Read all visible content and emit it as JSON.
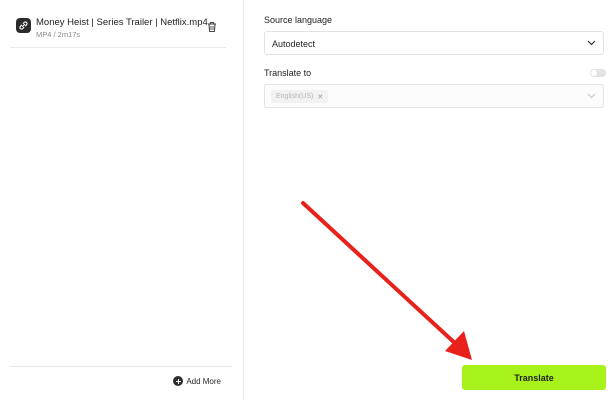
{
  "file": {
    "name": "Money Heist | Series Trailer | Netflix.mp4",
    "meta": "MP4 / 2m17s",
    "icon": "link-icon",
    "delete_icon": "trash-icon"
  },
  "left_footer": {
    "add_more_label": "Add More",
    "add_more_icon": "plus-circle-icon"
  },
  "source_language": {
    "label": "Source language",
    "value": "Autodetect"
  },
  "translate_to": {
    "label": "Translate to",
    "chips": [
      "English(US)"
    ],
    "toggle_on": false
  },
  "translate_button": {
    "label": "Translate",
    "color": "#a8f21b"
  },
  "annotation": {
    "arrow_color": "#e8211a"
  }
}
